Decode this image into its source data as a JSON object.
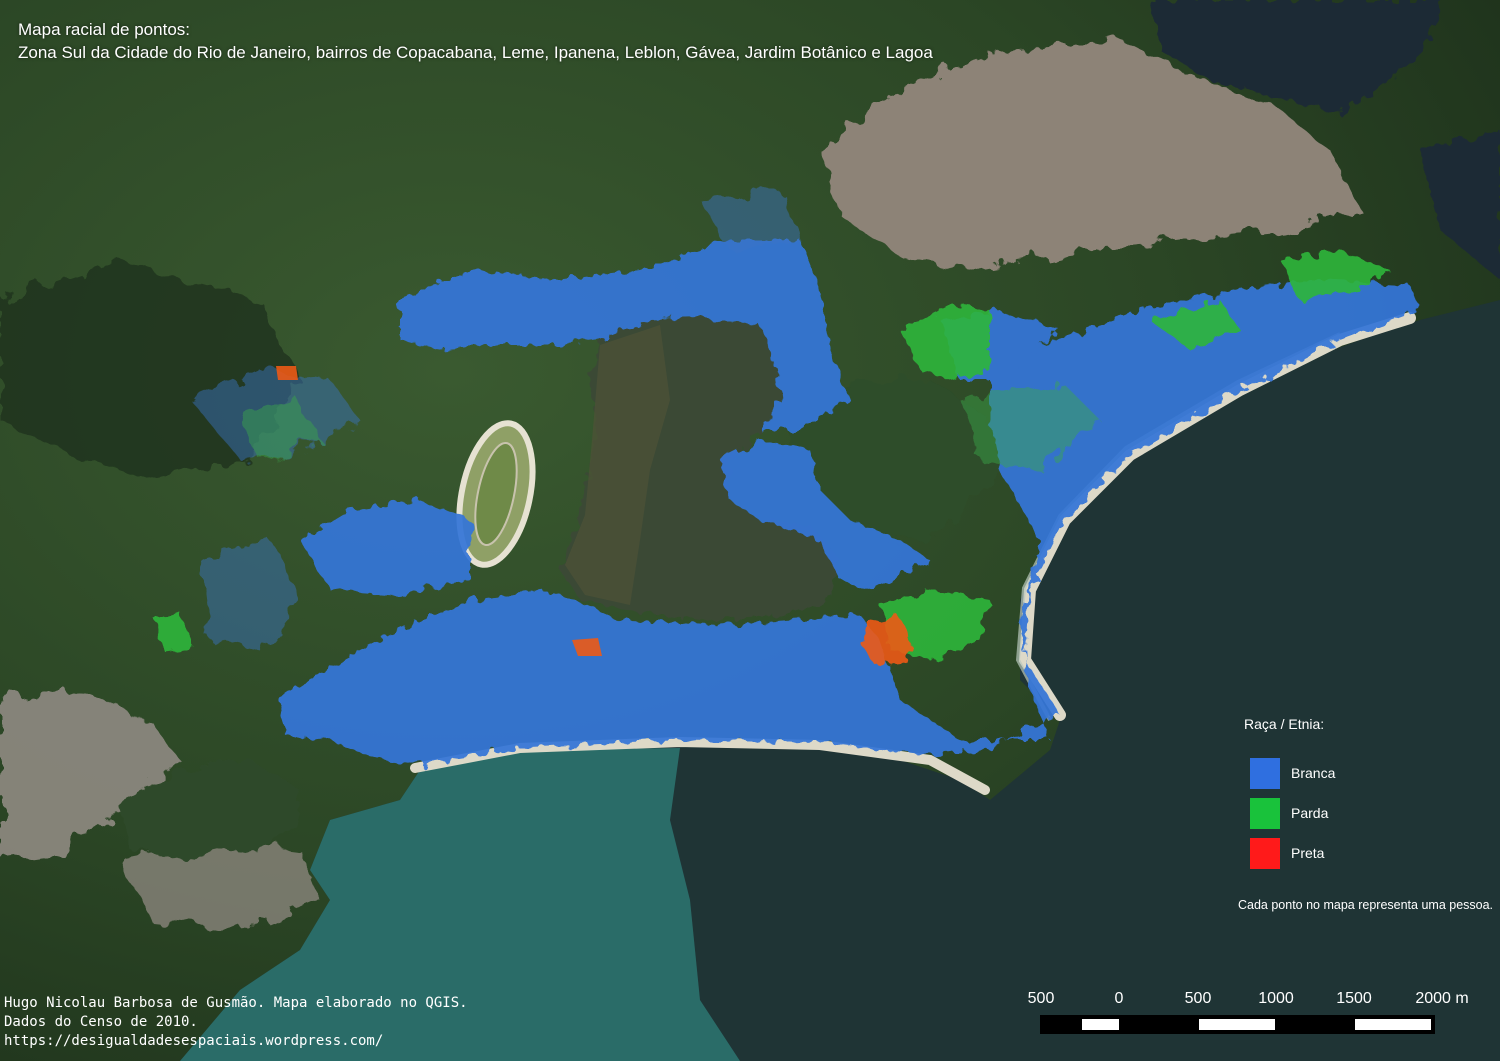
{
  "title": {
    "line1": "Mapa racial de pontos:",
    "line2": "Zona Sul da Cidade do Rio de Janeiro, bairros de Copacabana, Leme, Ipanena, Leblon, Gávea, Jardim Botânico e Lagoa"
  },
  "legend": {
    "title": "Raça / Etnia:",
    "items": [
      {
        "label": "Branca",
        "color": "#2f6fe0"
      },
      {
        "label": "Parda",
        "color": "#19c23b"
      },
      {
        "label": "Preta",
        "color": "#ff1a1a"
      }
    ],
    "note": "Cada ponto no mapa representa uma pessoa."
  },
  "credits": {
    "line1": "Hugo Nicolau Barbosa de Gusmão. Mapa elaborado no QGIS.",
    "line2": "Dados do Censo de 2010.",
    "line3": "https://desigualdadesespaciais.wordpress.com/"
  },
  "scale": {
    "labels": [
      "500",
      "0",
      "500",
      "1000",
      "1500",
      "2000 m"
    ],
    "segment_colors": [
      "#000000",
      "#ffffff"
    ]
  },
  "colors": {
    "forest": "#2c4a28",
    "urban": "#8e8478",
    "lagoon": "#3c4a36",
    "ocean": "#1f3434",
    "shallow_water": "#2a6c68",
    "sand": "#dedbcc"
  }
}
